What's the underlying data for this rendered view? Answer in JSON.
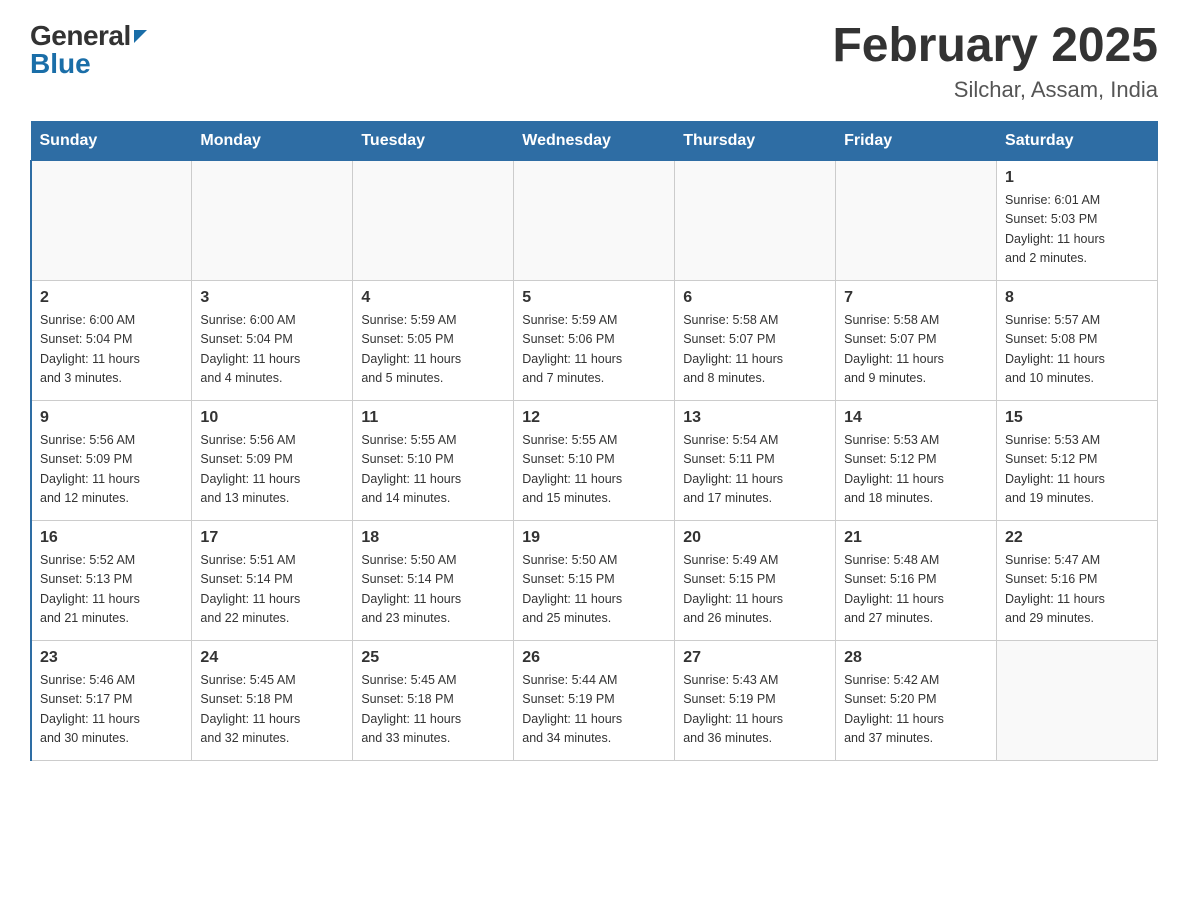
{
  "header": {
    "logo": {
      "general": "General",
      "blue": "Blue"
    },
    "title": "February 2025",
    "location": "Silchar, Assam, India"
  },
  "weekdays": [
    "Sunday",
    "Monday",
    "Tuesday",
    "Wednesday",
    "Thursday",
    "Friday",
    "Saturday"
  ],
  "weeks": [
    [
      {
        "day": "",
        "info": ""
      },
      {
        "day": "",
        "info": ""
      },
      {
        "day": "",
        "info": ""
      },
      {
        "day": "",
        "info": ""
      },
      {
        "day": "",
        "info": ""
      },
      {
        "day": "",
        "info": ""
      },
      {
        "day": "1",
        "info": "Sunrise: 6:01 AM\nSunset: 5:03 PM\nDaylight: 11 hours\nand 2 minutes."
      }
    ],
    [
      {
        "day": "2",
        "info": "Sunrise: 6:00 AM\nSunset: 5:04 PM\nDaylight: 11 hours\nand 3 minutes."
      },
      {
        "day": "3",
        "info": "Sunrise: 6:00 AM\nSunset: 5:04 PM\nDaylight: 11 hours\nand 4 minutes."
      },
      {
        "day": "4",
        "info": "Sunrise: 5:59 AM\nSunset: 5:05 PM\nDaylight: 11 hours\nand 5 minutes."
      },
      {
        "day": "5",
        "info": "Sunrise: 5:59 AM\nSunset: 5:06 PM\nDaylight: 11 hours\nand 7 minutes."
      },
      {
        "day": "6",
        "info": "Sunrise: 5:58 AM\nSunset: 5:07 PM\nDaylight: 11 hours\nand 8 minutes."
      },
      {
        "day": "7",
        "info": "Sunrise: 5:58 AM\nSunset: 5:07 PM\nDaylight: 11 hours\nand 9 minutes."
      },
      {
        "day": "8",
        "info": "Sunrise: 5:57 AM\nSunset: 5:08 PM\nDaylight: 11 hours\nand 10 minutes."
      }
    ],
    [
      {
        "day": "9",
        "info": "Sunrise: 5:56 AM\nSunset: 5:09 PM\nDaylight: 11 hours\nand 12 minutes."
      },
      {
        "day": "10",
        "info": "Sunrise: 5:56 AM\nSunset: 5:09 PM\nDaylight: 11 hours\nand 13 minutes."
      },
      {
        "day": "11",
        "info": "Sunrise: 5:55 AM\nSunset: 5:10 PM\nDaylight: 11 hours\nand 14 minutes."
      },
      {
        "day": "12",
        "info": "Sunrise: 5:55 AM\nSunset: 5:10 PM\nDaylight: 11 hours\nand 15 minutes."
      },
      {
        "day": "13",
        "info": "Sunrise: 5:54 AM\nSunset: 5:11 PM\nDaylight: 11 hours\nand 17 minutes."
      },
      {
        "day": "14",
        "info": "Sunrise: 5:53 AM\nSunset: 5:12 PM\nDaylight: 11 hours\nand 18 minutes."
      },
      {
        "day": "15",
        "info": "Sunrise: 5:53 AM\nSunset: 5:12 PM\nDaylight: 11 hours\nand 19 minutes."
      }
    ],
    [
      {
        "day": "16",
        "info": "Sunrise: 5:52 AM\nSunset: 5:13 PM\nDaylight: 11 hours\nand 21 minutes."
      },
      {
        "day": "17",
        "info": "Sunrise: 5:51 AM\nSunset: 5:14 PM\nDaylight: 11 hours\nand 22 minutes."
      },
      {
        "day": "18",
        "info": "Sunrise: 5:50 AM\nSunset: 5:14 PM\nDaylight: 11 hours\nand 23 minutes."
      },
      {
        "day": "19",
        "info": "Sunrise: 5:50 AM\nSunset: 5:15 PM\nDaylight: 11 hours\nand 25 minutes."
      },
      {
        "day": "20",
        "info": "Sunrise: 5:49 AM\nSunset: 5:15 PM\nDaylight: 11 hours\nand 26 minutes."
      },
      {
        "day": "21",
        "info": "Sunrise: 5:48 AM\nSunset: 5:16 PM\nDaylight: 11 hours\nand 27 minutes."
      },
      {
        "day": "22",
        "info": "Sunrise: 5:47 AM\nSunset: 5:16 PM\nDaylight: 11 hours\nand 29 minutes."
      }
    ],
    [
      {
        "day": "23",
        "info": "Sunrise: 5:46 AM\nSunset: 5:17 PM\nDaylight: 11 hours\nand 30 minutes."
      },
      {
        "day": "24",
        "info": "Sunrise: 5:45 AM\nSunset: 5:18 PM\nDaylight: 11 hours\nand 32 minutes."
      },
      {
        "day": "25",
        "info": "Sunrise: 5:45 AM\nSunset: 5:18 PM\nDaylight: 11 hours\nand 33 minutes."
      },
      {
        "day": "26",
        "info": "Sunrise: 5:44 AM\nSunset: 5:19 PM\nDaylight: 11 hours\nand 34 minutes."
      },
      {
        "day": "27",
        "info": "Sunrise: 5:43 AM\nSunset: 5:19 PM\nDaylight: 11 hours\nand 36 minutes."
      },
      {
        "day": "28",
        "info": "Sunrise: 5:42 AM\nSunset: 5:20 PM\nDaylight: 11 hours\nand 37 minutes."
      },
      {
        "day": "",
        "info": ""
      }
    ]
  ]
}
